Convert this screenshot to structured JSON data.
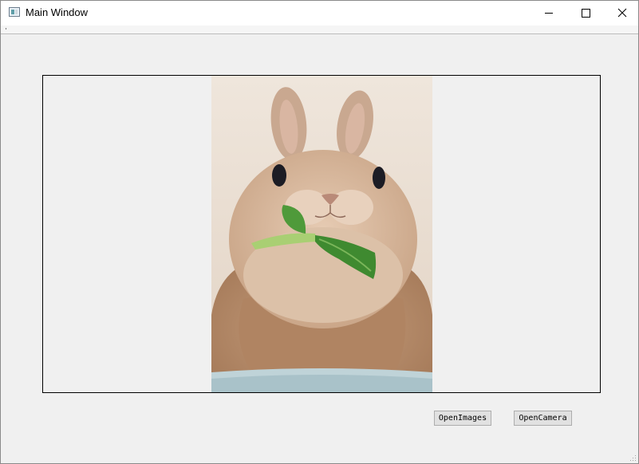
{
  "window": {
    "title": "Main Window"
  },
  "title_bar": {
    "controls": [
      {
        "name": "minimize",
        "icon": "minimize-icon"
      },
      {
        "name": "maximize",
        "icon": "maximize-icon"
      },
      {
        "name": "close",
        "icon": "close-icon"
      }
    ]
  },
  "image_view": {
    "content": "photo of a rabbit eating a green leaf"
  },
  "buttons": {
    "open_images": "OpenImages",
    "open_camera": "OpenCamera"
  },
  "colors": {
    "window_bg": "#f0f0f0",
    "titlebar_bg": "#ffffff",
    "button_bg": "#e1e1e1",
    "button_border": "#adadad"
  }
}
